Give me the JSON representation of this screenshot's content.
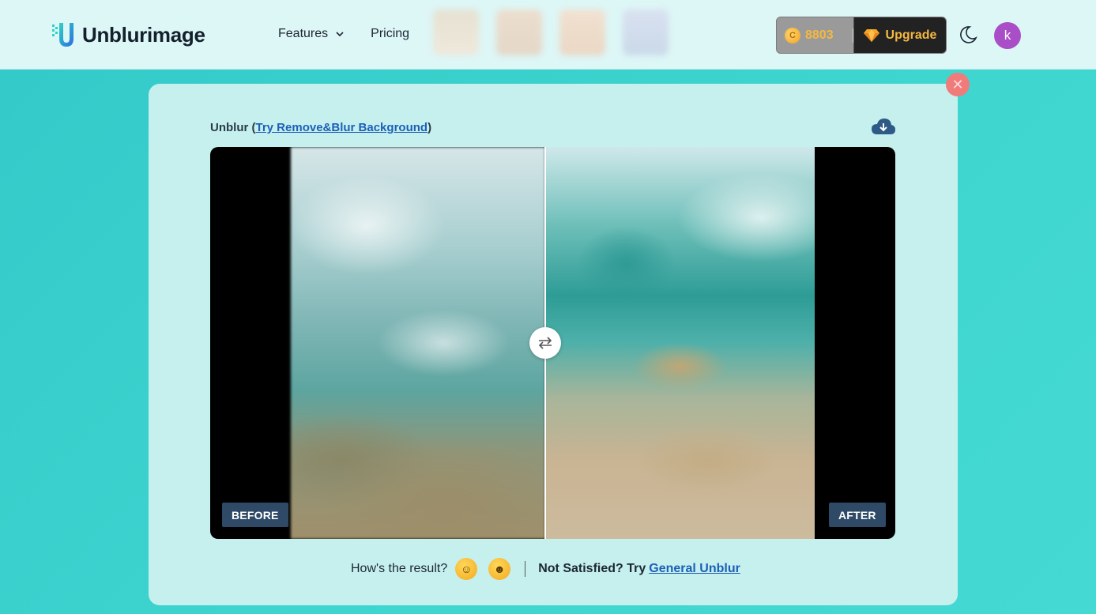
{
  "header": {
    "logo_text": "Unblurimage",
    "nav": {
      "features": "Features",
      "pricing": "Pricing"
    },
    "credits": "8803",
    "upgrade": "Upgrade",
    "avatar_letter": "k"
  },
  "card": {
    "title_prefix": "Unblur (",
    "title_link": "Try Remove&Blur Background",
    "title_suffix": ")",
    "before_label": "BEFORE",
    "after_label": "AFTER"
  },
  "feedback": {
    "question": "How's the result?",
    "not_satisfied": "Not Satisfied? Try",
    "link": "General Unblur"
  },
  "colors": {
    "accent": "#1c5fb7",
    "upgrade_text": "#f5b841",
    "avatar": "#a94ec7",
    "close": "#f07b7b",
    "tag": "#2e4a66"
  },
  "icons": [
    "logo-icon",
    "chevron-down-icon",
    "coin-icon",
    "gem-icon",
    "moon-icon",
    "close-icon",
    "cloud-download-icon",
    "swap-icon",
    "grinning-face-icon",
    "relieved-face-icon"
  ]
}
